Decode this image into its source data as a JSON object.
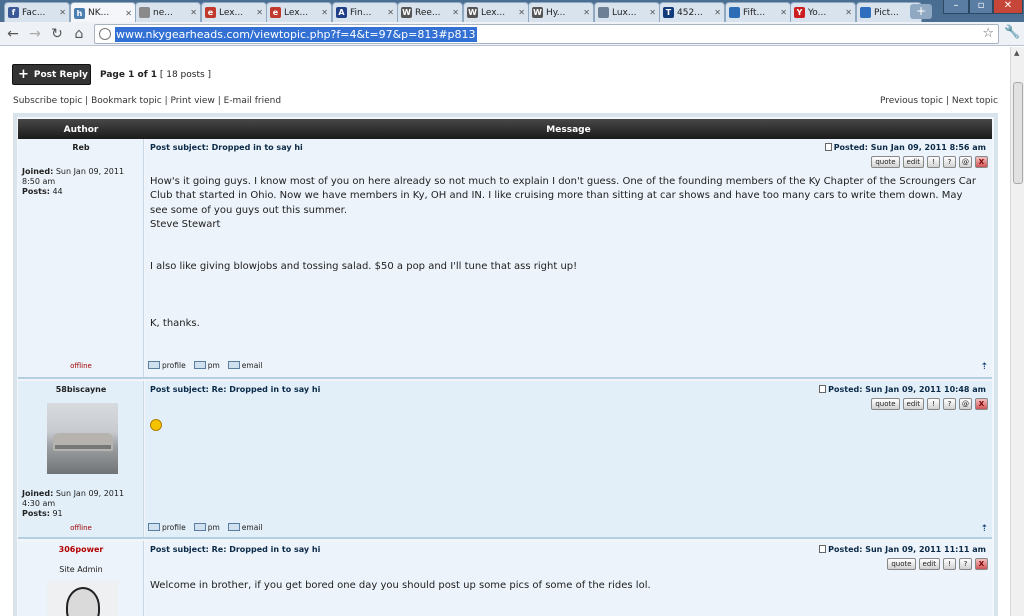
{
  "browser": {
    "tabs": [
      {
        "label": "Fac...",
        "icon": "facebook-icon",
        "color": "#3b5998",
        "glyph": "f"
      },
      {
        "label": "NK...",
        "icon": "site-h-icon",
        "color": "#4a7fb0",
        "glyph": "h",
        "active": true
      },
      {
        "label": "ne...",
        "icon": "page-icon",
        "color": "#8a8a8a",
        "glyph": ""
      },
      {
        "label": "Lex...",
        "icon": "ebay-icon",
        "color": "#c0392b",
        "glyph": "e"
      },
      {
        "label": "Lex...",
        "icon": "ebay-icon",
        "color": "#c0392b",
        "glyph": "e"
      },
      {
        "label": "Fin...",
        "icon": "circle-a-icon",
        "color": "#1f3f88",
        "glyph": "A"
      },
      {
        "label": "Ree...",
        "icon": "wikipedia-icon",
        "color": "#555555",
        "glyph": "W"
      },
      {
        "label": "Lex...",
        "icon": "wikipedia-icon",
        "color": "#555555",
        "glyph": "W"
      },
      {
        "label": "Hy...",
        "icon": "wikipedia-icon",
        "color": "#555555",
        "glyph": "W"
      },
      {
        "label": "Lux...",
        "icon": "page-icon",
        "color": "#6d7f95",
        "glyph": ""
      },
      {
        "label": "452...",
        "icon": "twc-icon",
        "color": "#113a7a",
        "glyph": "T"
      },
      {
        "label": "Fift...",
        "icon": "globe-tab-icon",
        "color": "#2d6db5",
        "glyph": ""
      },
      {
        "label": "Yo...",
        "icon": "youtube-icon",
        "color": "#cc1e1e",
        "glyph": "Y"
      },
      {
        "label": "Pict...",
        "icon": "photobucket-icon",
        "color": "#2f6dbd",
        "glyph": ""
      }
    ],
    "url": "www.nkygearheads.com/viewtopic.php?f=4&t=97&p=813#p813"
  },
  "topic": {
    "post_reply_label": "Post Reply",
    "page_prefix": "Page ",
    "page_number": "1",
    "page_of": " of ",
    "page_total": "1",
    "posts_count": " [ 18 posts ]",
    "subscribe": "Subscribe topic",
    "bookmark": "Bookmark topic",
    "print": "Print view",
    "email_friend": "E-mail friend",
    "previous": "Previous topic",
    "next": "Next topic",
    "separator": "|"
  },
  "table": {
    "author_header": "Author",
    "message_header": "Message"
  },
  "buttons": {
    "quote": "quote",
    "edit": "edit",
    "info": "!",
    "report": "?",
    "warn": "@",
    "delete": "X"
  },
  "contact": {
    "profile": "profile",
    "pm": "pm",
    "email": "email"
  },
  "posts": [
    {
      "author": "Reb",
      "joined_label": "Joined:",
      "joined": "Sun Jan 09, 2011 8:50 am",
      "posts_label": "Posts:",
      "posts": "44",
      "status": "offline",
      "subject": "Post subject: Dropped in to say hi",
      "posted": "Posted: Sun Jan 09, 2011 8:56 am",
      "body": [
        "How's it going guys. I know most of you on here already so not much to explain I don't guess. One of the founding members of the Ky Chapter of the Scroungers Car Club that started in Ohio. Now we have members in Ky, OH and IN. I like cruising more than sitting at car shows and have too many cars to write them down. May see some of you guys out this summer.",
        "Steve Stewart",
        "I also like giving blowjobs and tossing salad. $50 a pop and I'll tune that ass right up!",
        "K, thanks."
      ]
    },
    {
      "author": "58biscayne",
      "joined_label": "Joined:",
      "joined": "Sun Jan 09, 2011 4:30 am",
      "posts_label": "Posts:",
      "posts": "91",
      "status": "offline",
      "subject": "Post subject: Re: Dropped in to say hi",
      "posted": "Posted: Sun Jan 09, 2011 10:48 am"
    },
    {
      "author": "306power",
      "rank": "Site Admin",
      "subject": "Post subject: Re: Dropped in to say hi",
      "posted": "Posted: Sun Jan 09, 2011 11:11 am",
      "body": [
        "Welcome in brother, if you get bored one day you should post up some pics of some of the rides lol."
      ]
    }
  ]
}
